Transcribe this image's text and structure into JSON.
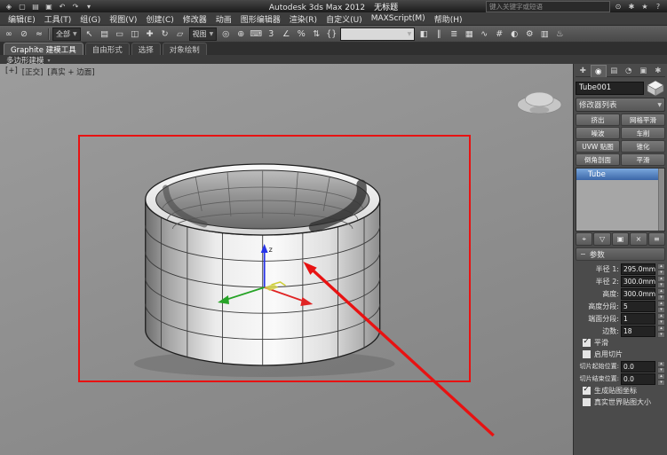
{
  "window": {
    "title": "Autodesk 3ds Max 2012",
    "doc_title": "无标题",
    "search_placeholder": "键入关键字或短语"
  },
  "titlebar": {
    "left_icons": [
      {
        "name": "app-logo-icon",
        "glyph": "◈"
      },
      {
        "name": "new-scene-icon",
        "glyph": "▢"
      },
      {
        "name": "open-scene-icon",
        "glyph": "▤"
      },
      {
        "name": "save-scene-icon",
        "glyph": "▣"
      },
      {
        "name": "undo-icon",
        "glyph": "↶"
      },
      {
        "name": "redo-icon",
        "glyph": "↷"
      },
      {
        "name": "project-menu-icon",
        "glyph": "▾"
      }
    ],
    "right_icons": [
      {
        "name": "search-icon",
        "glyph": "⊙"
      },
      {
        "name": "communication-center-icon",
        "glyph": "✱"
      },
      {
        "name": "favorites-icon",
        "glyph": "★"
      },
      {
        "name": "help-icon",
        "glyph": "?"
      }
    ]
  },
  "menubar": {
    "items": [
      "编辑(E)",
      "工具(T)",
      "组(G)",
      "视图(V)",
      "创建(C)",
      "修改器",
      "动画",
      "图形编辑器",
      "渲染(R)",
      "自定义(U)",
      "MAXScript(M)",
      "帮助(H)"
    ]
  },
  "toolbar": {
    "icons_a": [
      {
        "name": "select-and-link-icon",
        "glyph": "∞"
      },
      {
        "name": "unlink-selection-icon",
        "glyph": "⊘"
      },
      {
        "name": "bind-to-space-warp-icon",
        "glyph": "≈"
      }
    ],
    "selection_filter": "全部",
    "icons_b": [
      {
        "name": "select-object-icon",
        "glyph": "↖"
      },
      {
        "name": "select-by-name-icon",
        "glyph": "▤"
      },
      {
        "name": "rectangular-selection-region-icon",
        "glyph": "▭"
      },
      {
        "name": "window-crossing-icon",
        "glyph": "◫"
      },
      {
        "name": "select-and-move-icon",
        "glyph": "✚"
      },
      {
        "name": "select-and-rotate-icon",
        "glyph": "↻"
      },
      {
        "name": "select-and-scale-icon",
        "glyph": "▱"
      }
    ],
    "coord_system": "视图",
    "icons_c": [
      {
        "name": "use-pivot-center-icon",
        "glyph": "◎"
      },
      {
        "name": "select-and-manipulate-icon",
        "glyph": "⊕"
      },
      {
        "name": "keyboard-shortcut-override-icon",
        "glyph": "⌨"
      },
      {
        "name": "snaps-toggle-3d-icon",
        "glyph": "3"
      },
      {
        "name": "angle-snap-icon",
        "glyph": "∠"
      },
      {
        "name": "percent-snap-icon",
        "glyph": "%"
      },
      {
        "name": "spinner-snap-icon",
        "glyph": "⇅"
      },
      {
        "name": "edit-named-selection-sets-icon",
        "glyph": "{}"
      }
    ],
    "icons_d": [
      {
        "name": "mirror-icon",
        "glyph": "◧"
      },
      {
        "name": "align-icon",
        "glyph": "∥"
      },
      {
        "name": "layer-manager-icon",
        "glyph": "≣"
      },
      {
        "name": "graphite-ribbon-toggle-icon",
        "glyph": "▦"
      },
      {
        "name": "curve-editor-icon",
        "glyph": "∿"
      },
      {
        "name": "schematic-view-icon",
        "glyph": "#"
      },
      {
        "name": "material-editor-icon",
        "glyph": "◐"
      },
      {
        "name": "render-setup-icon",
        "glyph": "⚙"
      },
      {
        "name": "rendered-frame-icon",
        "glyph": "▥"
      },
      {
        "name": "render-production-icon",
        "glyph": "♨"
      }
    ]
  },
  "ribbon": {
    "tabs": [
      {
        "label": "Graphite 建模工具",
        "cls": "active"
      },
      {
        "label": "自由形式",
        "cls": ""
      },
      {
        "label": "选择",
        "cls": ""
      },
      {
        "label": "对象绘制",
        "cls": ""
      }
    ],
    "minimize_caret": "▾",
    "strip_label": "多边形建模",
    "strip_caret": "▾"
  },
  "viewport": {
    "label_menu": "[+]",
    "label_pov": "[正交]",
    "label_shading": "[真实 + 边面]",
    "object": "Tube"
  },
  "command_panel": {
    "tabs": [
      {
        "name": "tab-create-icon",
        "glyph": "✚",
        "cls": ""
      },
      {
        "name": "tab-modify-icon",
        "glyph": "◉",
        "cls": "active"
      },
      {
        "name": "tab-hierarchy-icon",
        "glyph": "▤",
        "cls": ""
      },
      {
        "name": "tab-motion-icon",
        "glyph": "◔",
        "cls": ""
      },
      {
        "name": "tab-display-icon",
        "glyph": "▣",
        "cls": ""
      },
      {
        "name": "tab-utilities-icon",
        "glyph": "✱",
        "cls": ""
      }
    ],
    "object_name": "Tube001",
    "modifier_list_label": "修改器列表",
    "modifier_buttons": [
      "挤出",
      "网格平滑",
      "噪波",
      "车削",
      "UVW 贴图",
      "锥化",
      "倒角剖面",
      "平滑"
    ],
    "stack_items": [
      {
        "label": "Tube",
        "cls": "selected"
      }
    ],
    "stack_tools": [
      {
        "name": "pin-stack-icon",
        "glyph": "⌖"
      },
      {
        "name": "show-end-result-icon",
        "glyph": "▽"
      },
      {
        "name": "make-unique-icon",
        "glyph": "▣"
      },
      {
        "name": "remove-modifier-icon",
        "glyph": "×"
      },
      {
        "name": "configure-modifier-sets-icon",
        "glyph": "≡"
      }
    ],
    "params": {
      "title": "参数",
      "spinners": [
        {
          "label": "半径 1:",
          "value": "295.0mm"
        },
        {
          "label": "半径 2:",
          "value": "300.0mm"
        },
        {
          "label": "高度:",
          "value": "300.0mm"
        },
        {
          "label": "高度分段:",
          "value": "5"
        },
        {
          "label": "端面分段:",
          "value": "1"
        },
        {
          "label": "边数:",
          "value": "18"
        }
      ],
      "checks1": [
        {
          "label": "平滑",
          "checked": true
        },
        {
          "label": "启用切片",
          "checked": false
        }
      ],
      "slice_spinners": [
        {
          "label": "切片起始位置:",
          "value": "0.0"
        },
        {
          "label": "切片结束位置:",
          "value": "0.0"
        }
      ],
      "checks2": [
        {
          "label": "生成贴图坐标",
          "checked": true
        },
        {
          "label": "真实世界贴图大小",
          "checked": false
        }
      ]
    }
  },
  "colors": {
    "annotation_red": "#e81212",
    "stack_selection_blue": "#3c67a8",
    "viewport_gray": "#8f8f8f"
  }
}
